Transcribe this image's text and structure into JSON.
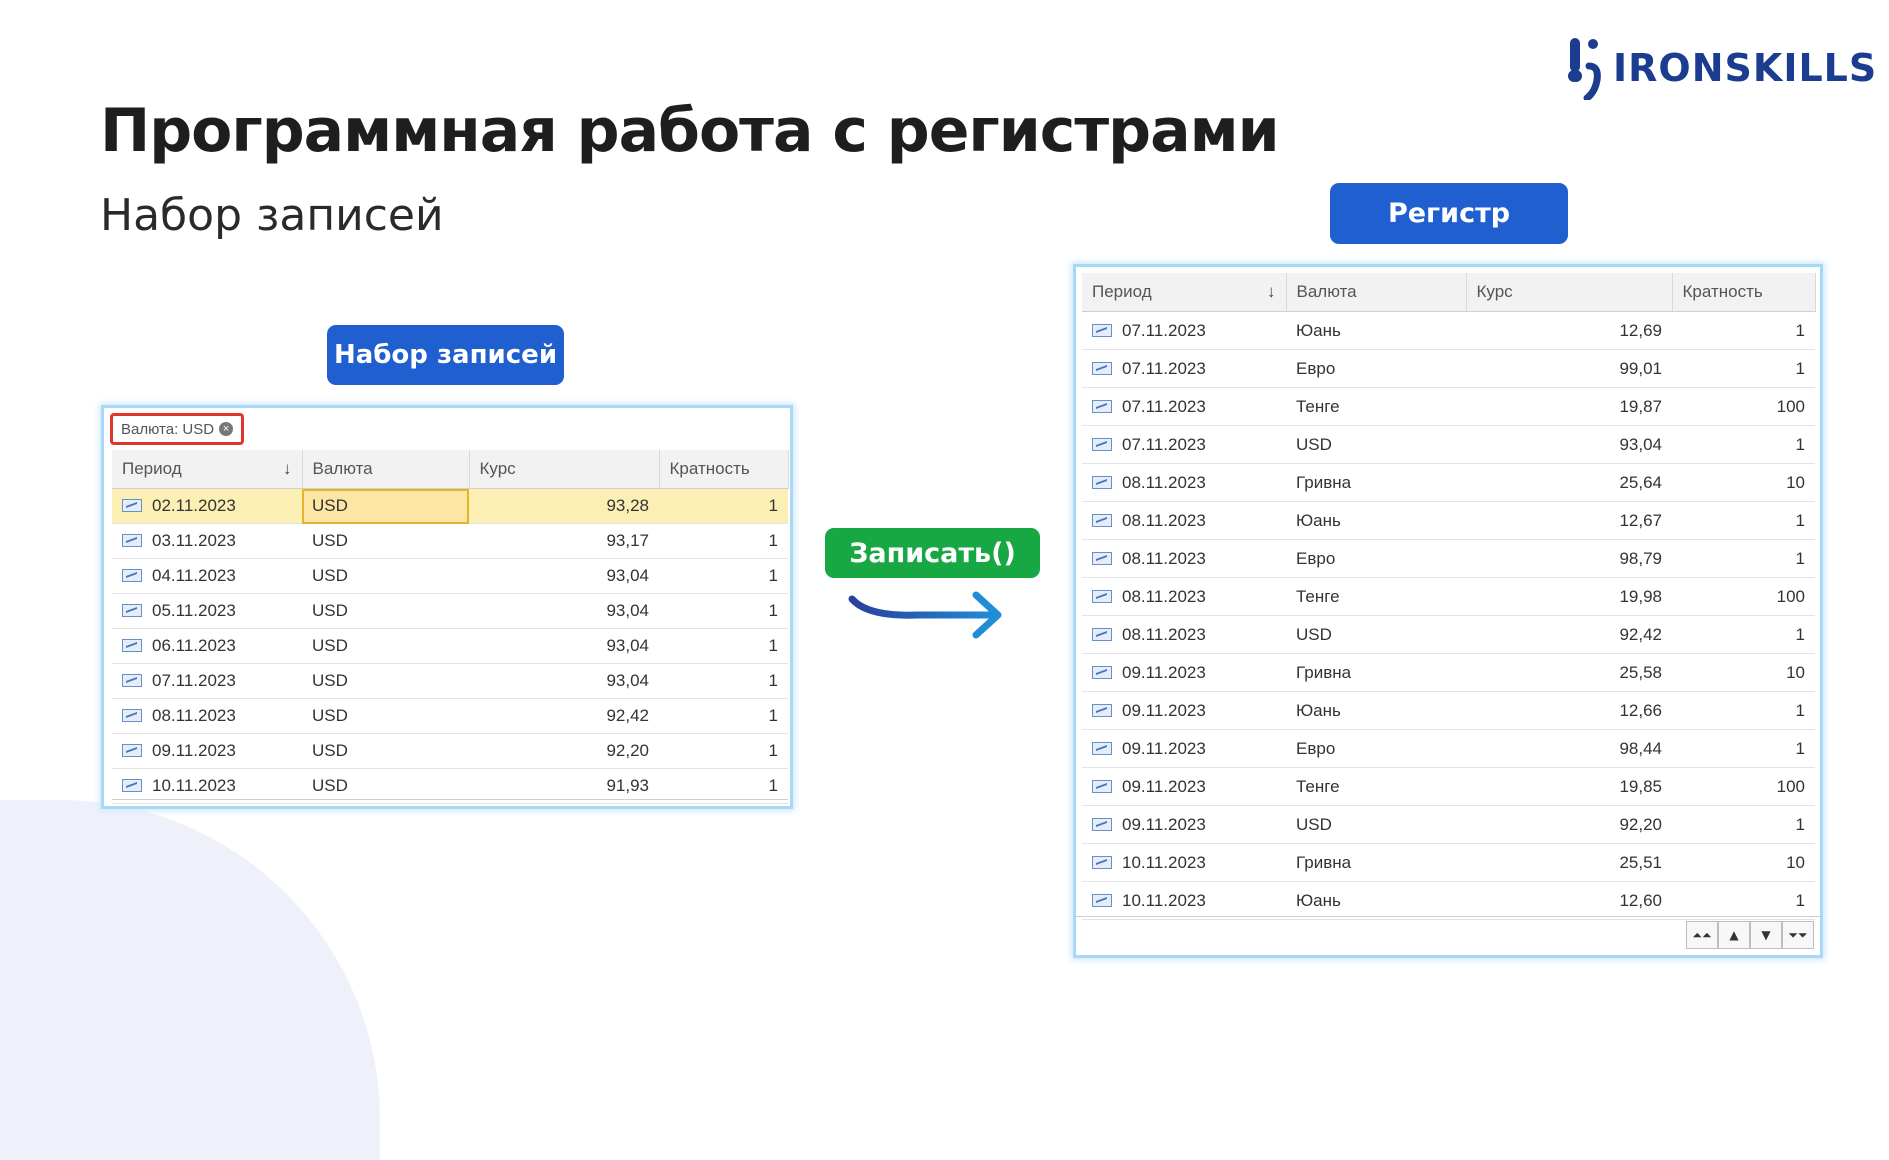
{
  "logo": {
    "text": "IRONSKILLS"
  },
  "title": "Программная работа с регистрами",
  "subtitle": "Набор записей",
  "labels": {
    "register": "Регистр",
    "record_set": "Набор записей",
    "write": "Записать()"
  },
  "record_set": {
    "filter_chip": "Валюта: USD",
    "columns": [
      "Период",
      "Валюта",
      "Курс",
      "Кратность"
    ],
    "rows": [
      [
        "02.11.2023",
        "USD",
        "93,28",
        "1"
      ],
      [
        "03.11.2023",
        "USD",
        "93,17",
        "1"
      ],
      [
        "04.11.2023",
        "USD",
        "93,04",
        "1"
      ],
      [
        "05.11.2023",
        "USD",
        "93,04",
        "1"
      ],
      [
        "06.11.2023",
        "USD",
        "93,04",
        "1"
      ],
      [
        "07.11.2023",
        "USD",
        "93,04",
        "1"
      ],
      [
        "08.11.2023",
        "USD",
        "92,42",
        "1"
      ],
      [
        "09.11.2023",
        "USD",
        "92,20",
        "1"
      ],
      [
        "10.11.2023",
        "USD",
        "91,93",
        "1"
      ]
    ]
  },
  "register": {
    "columns": [
      "Период",
      "Валюта",
      "Курс",
      "Кратность"
    ],
    "rows": [
      [
        "07.11.2023",
        "Юань",
        "12,69",
        "1"
      ],
      [
        "07.11.2023",
        "Евро",
        "99,01",
        "1"
      ],
      [
        "07.11.2023",
        "Тенге",
        "19,87",
        "100"
      ],
      [
        "07.11.2023",
        "USD",
        "93,04",
        "1"
      ],
      [
        "08.11.2023",
        "Гривна",
        "25,64",
        "10"
      ],
      [
        "08.11.2023",
        "Юань",
        "12,67",
        "1"
      ],
      [
        "08.11.2023",
        "Евро",
        "98,79",
        "1"
      ],
      [
        "08.11.2023",
        "Тенге",
        "19,98",
        "100"
      ],
      [
        "08.11.2023",
        "USD",
        "92,42",
        "1"
      ],
      [
        "09.11.2023",
        "Гривна",
        "25,58",
        "10"
      ],
      [
        "09.11.2023",
        "Юань",
        "12,66",
        "1"
      ],
      [
        "09.11.2023",
        "Евро",
        "98,44",
        "1"
      ],
      [
        "09.11.2023",
        "Тенге",
        "19,85",
        "100"
      ],
      [
        "09.11.2023",
        "USD",
        "92,20",
        "1"
      ],
      [
        "10.11.2023",
        "Гривна",
        "25,51",
        "10"
      ],
      [
        "10.11.2023",
        "Юань",
        "12,60",
        "1"
      ]
    ],
    "nav_buttons": [
      "⏶⏶",
      "▲",
      "▼",
      "⏷⏷"
    ]
  },
  "colors": {
    "accent_blue": "#1f5fd0",
    "accent_green": "#17a843",
    "logo": "#1c3d8f"
  },
  "icons": [
    "logo-mark-icon",
    "sort-down-icon",
    "clear-filter-icon",
    "record-row-icon",
    "right-arrow-icon"
  ]
}
